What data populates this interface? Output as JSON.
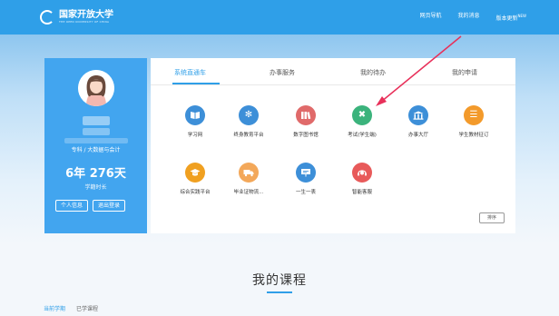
{
  "header": {
    "logo_name": "国家开放大学",
    "logo_sub": "THE OPEN UNIVERSITY OF CHINA",
    "links": [
      "网页导航",
      "我的消息",
      "版本更新"
    ],
    "new_badge": "NEW"
  },
  "profile": {
    "major": "专科 / 大数据与会计",
    "duration": "6年 276天",
    "duration_label": "学籍时长",
    "buttons": [
      "个人信息",
      "退出登录"
    ]
  },
  "panel": {
    "tabs": [
      "系统直通车",
      "办事服务",
      "我的待办",
      "我的申请"
    ],
    "active_tab": 0,
    "apps": [
      {
        "label": "学习网",
        "icon": "book-icon",
        "color": "#3d8fd8"
      },
      {
        "label": "终身教育平台",
        "icon": "snowflake-icon",
        "color": "#3d8fd8"
      },
      {
        "label": "数字图书馆",
        "icon": "library-icon",
        "color": "#e06a6a"
      },
      {
        "label": "考试(学生端)",
        "icon": "exam-icon",
        "color": "#3bb37c"
      },
      {
        "label": "办事大厅",
        "icon": "building-icon",
        "color": "#3d8fd8"
      },
      {
        "label": "学生教材征订",
        "icon": "textbook-icon",
        "color": "#f39a2b"
      },
      {
        "label": "综合实践平台",
        "icon": "graduation-cap-icon",
        "color": "#f0a020"
      },
      {
        "label": "毕业证物流...",
        "icon": "truck-icon",
        "color": "#f3a85a"
      },
      {
        "label": "一生一表",
        "icon": "board-icon",
        "color": "#3d8fd8"
      },
      {
        "label": "智能客服",
        "icon": "headset-icon",
        "color": "#e85a5a"
      }
    ],
    "sort_label": "排序"
  },
  "courses": {
    "title": "我的课程",
    "tabs": [
      "当前学期",
      "已学课程"
    ],
    "active_tab": 0
  }
}
